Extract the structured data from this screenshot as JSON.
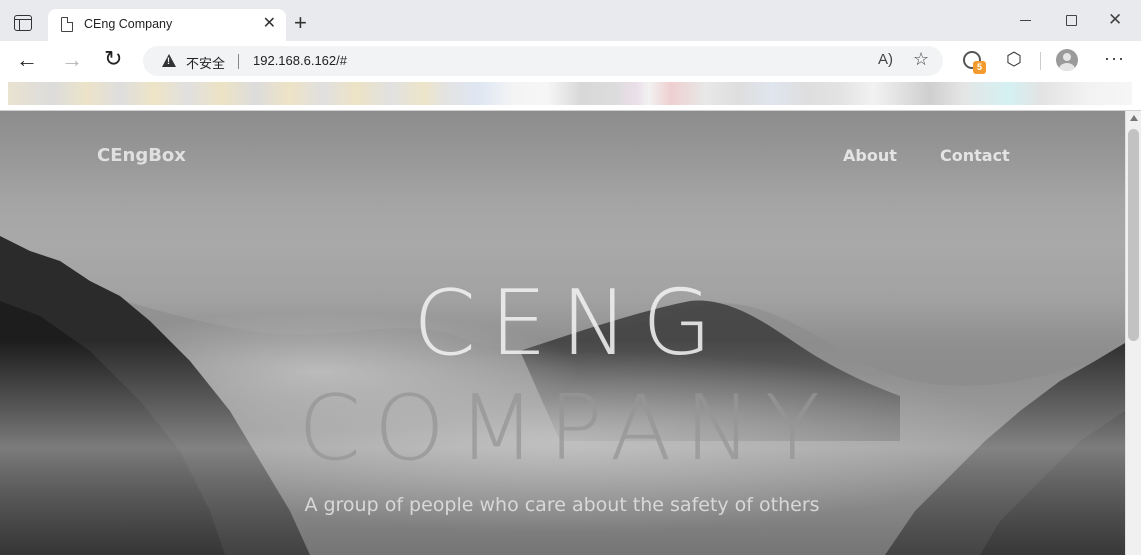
{
  "browser": {
    "tab_title": "CEng Company",
    "security_label": "不安全",
    "url": "192.168.6.162/#",
    "extension_badge": "5"
  },
  "site": {
    "brand": "CEngBox",
    "nav": [
      "About",
      "Contact"
    ],
    "headline_line1": "CENG",
    "headline_line2": "COMPANY",
    "tagline": "A group of people who care about the safety of others"
  },
  "colors": {
    "badge": "#f29b2e",
    "hero_tint": "#8d8d8d"
  }
}
